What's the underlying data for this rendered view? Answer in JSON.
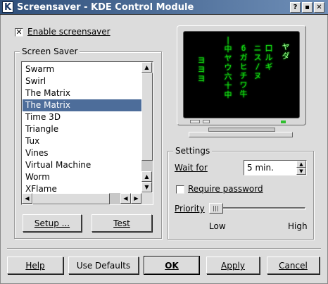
{
  "window": {
    "app_icon": "K",
    "title": "Screensaver - KDE Control Module",
    "help_label": "?",
    "minimize_label": "▪",
    "close_label": "✕"
  },
  "enable": {
    "checked_mark": "✕",
    "label": "Enable screensaver"
  },
  "screen_saver_group": {
    "title": "Screen Saver",
    "items": [
      {
        "label": "Swarm",
        "selected": false
      },
      {
        "label": "Swirl",
        "selected": false
      },
      {
        "label": "The Matrix",
        "selected": false
      },
      {
        "label": "The Matrix",
        "selected": true
      },
      {
        "label": "Time 3D",
        "selected": false
      },
      {
        "label": "Triangle",
        "selected": false
      },
      {
        "label": "Tux",
        "selected": false
      },
      {
        "label": "Vines",
        "selected": false
      },
      {
        "label": "Virtual Machine",
        "selected": false
      },
      {
        "label": "Worm",
        "selected": false
      },
      {
        "label": "XFlame",
        "selected": false
      }
    ],
    "setup_button": "Setup ...",
    "test_button": "Test"
  },
  "settings_group": {
    "title": "Settings",
    "wait_for_label": "Wait for",
    "wait_for_value": "5 min.",
    "require_password_label": "Require password",
    "priority_label": "Priority",
    "priority_level": 0,
    "low_label": "Low",
    "high_label": "High"
  },
  "footer": {
    "help": "Help",
    "use_defaults": "Use Defaults",
    "ok": "OK",
    "apply": "Apply",
    "cancel": "Cancel"
  },
  "preview": {
    "icon": "monitor-preview-icon",
    "colors": {
      "screen": "#000000",
      "glyphs": "#16d416",
      "led": "#2fbf2f"
    }
  }
}
